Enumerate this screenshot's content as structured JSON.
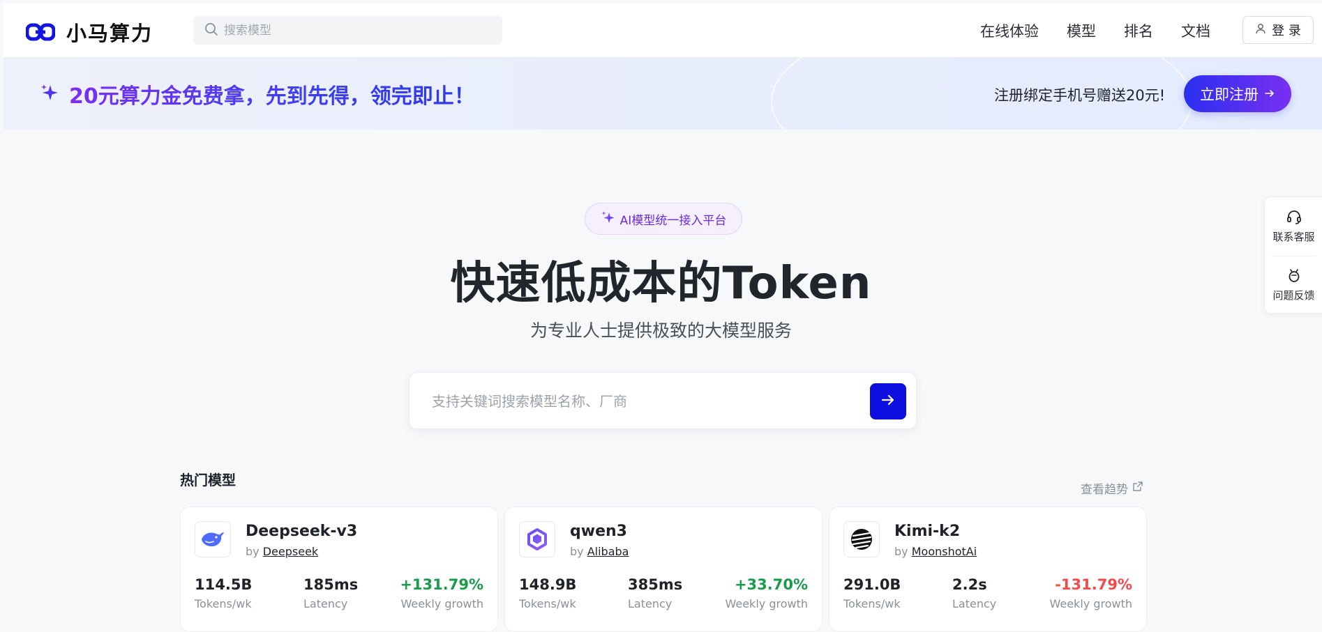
{
  "header": {
    "brand_name": "小马算力",
    "logo_icon": "link-chain-logo",
    "search_placeholder": "搜索模型",
    "nav": [
      "在线体验",
      "模型",
      "排名",
      "文档"
    ],
    "login_label": "登 录"
  },
  "promo": {
    "title": "20元算力金免费拿，先到先得，领完即止！",
    "note": "注册绑定手机号赠送20元!",
    "button_label": "立即注册"
  },
  "hero": {
    "pill_label": "AI模型统一接入平台",
    "title": "快速低成本的Token",
    "subtitle": "为专业人士提供极致的大模型服务",
    "search_placeholder": "支持关键词搜索模型名称、厂商"
  },
  "hot": {
    "section_title": "热门模型",
    "trend_link": "查看趋势",
    "cards": [
      {
        "name": "Deepseek-v3",
        "by_prefix": "by",
        "vendor": "Deepseek",
        "tokens": "114.5B",
        "tokens_label": "Tokens/wk",
        "latency": "185ms",
        "latency_label": "Latency",
        "growth": "+131.79%",
        "growth_label": "Weekly growth",
        "trend": "up"
      },
      {
        "name": "qwen3",
        "by_prefix": "by",
        "vendor": "Alibaba",
        "tokens": "148.9B",
        "tokens_label": "Tokens/wk",
        "latency": "385ms",
        "latency_label": "Latency",
        "growth": "+33.70%",
        "growth_label": "Weekly growth",
        "trend": "up"
      },
      {
        "name": "Kimi-k2",
        "by_prefix": "by",
        "vendor": "MoonshotAi",
        "tokens": "291.0B",
        "tokens_label": "Tokens/wk",
        "latency": "2.2s",
        "latency_label": "Latency",
        "growth": "-131.79%",
        "growth_label": "Weekly growth",
        "trend": "down"
      }
    ]
  },
  "side": {
    "support_label": "联系客服",
    "feedback_label": "问题反馈"
  },
  "colors": {
    "brand_blue": "#0d0ee0",
    "promo_purple": "#7b2ff2",
    "growth_up": "#1a9a4a",
    "growth_down": "#ef4b4b"
  }
}
